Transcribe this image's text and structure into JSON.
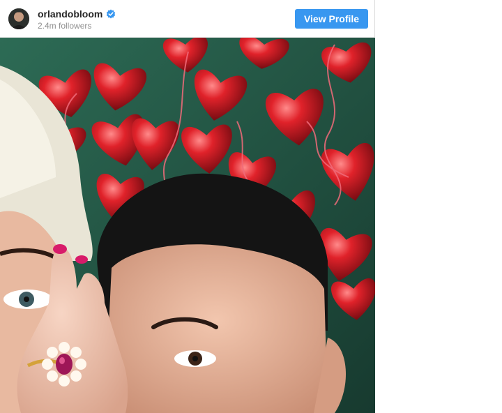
{
  "post": {
    "username": "orlandobloom",
    "verified": true,
    "followers": "2.4m followers",
    "view_profile_label": "View Profile"
  },
  "icons": {
    "verified": "verified-badge-icon"
  },
  "colors": {
    "button_blue": "#3897f0",
    "verified_blue": "#3897f0",
    "username_text": "#262626",
    "secondary_text": "#8e8e8e"
  },
  "image": {
    "alt_description": "Close-up selfie of a couple in front of red heart-shaped balloons, a woman covering one eye with her hand showing an engagement ring"
  }
}
